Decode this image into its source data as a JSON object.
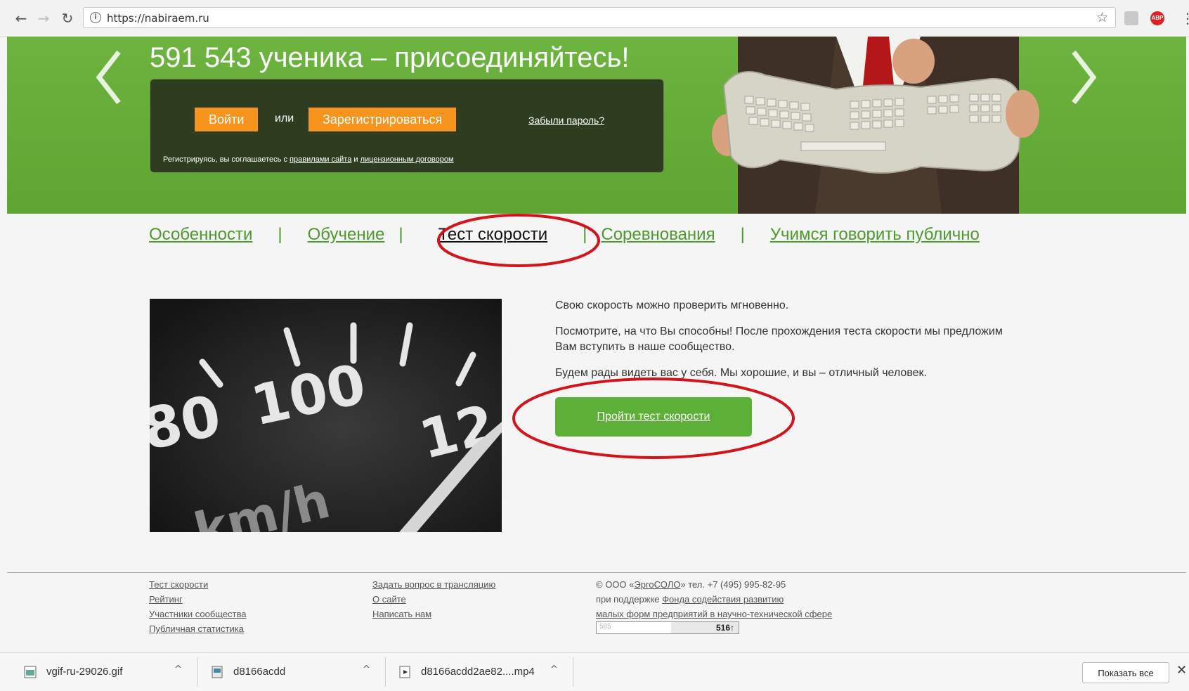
{
  "browser": {
    "back_icon": "←",
    "forward_icon": "→",
    "reload_icon": "↻",
    "url": "https://nabiraem.ru",
    "star_icon": "☆",
    "menu_icon": "⋮",
    "abp_label": "ABP"
  },
  "hero": {
    "title": "591 543 ученика – присоединяйтесь!",
    "login_label": "Войти",
    "or_label": "или",
    "register_label": "Зарегистрироваться",
    "forgot_label": "Забыли пароль?",
    "terms_prefix": "Регистрируясь, вы соглашаетесь с",
    "terms_rules": "правилами сайта",
    "terms_and": "и",
    "terms_license": "лицензионным договором",
    "accent_color": "#f7941d"
  },
  "tabs": [
    "Особенности",
    "Обучение",
    "Тест скорости",
    "Соревнования",
    "Учимся говорить публично"
  ],
  "tab_separator": "|",
  "main": {
    "p1": "Свою скорость можно проверить мгновенно.",
    "p2": "Посмотрите, на что Вы способны! После прохождения теста скорости мы предложим Вам вступить в наше сообщество.",
    "p3": "Будем рады видеть вас у себя. Мы хорошие, и вы – отличный человек.",
    "cta_label": "Пройти тест скорости",
    "speedo_labels": [
      "80",
      "100",
      "12",
      "km/h"
    ]
  },
  "footer": {
    "col1": [
      "Тест скорости",
      "Рейтинг",
      "Участники сообщества",
      "Публичная статистика"
    ],
    "col2": [
      "Задать вопрос в трансляцию",
      "О сайте",
      "Написать нам"
    ],
    "copyright_prefix": "© ООО «",
    "company": "ЭргоСОЛО",
    "copyright_suffix": "» тел. +7 (495) 995-82-95",
    "support_prefix": "при поддержке",
    "fund_link1": "Фонда содействия развитию",
    "fund_link2": "малых форм предприятий в научно-технической сфере",
    "counter_left": "585",
    "counter_value": "516↑"
  },
  "downloads": {
    "items": [
      "vgif-ru-29026.gif",
      "d8166acdd",
      "d8166acdd2ae82....mp4"
    ],
    "caret": "^",
    "show_all_label": "Показать все",
    "close_icon": "✕"
  }
}
